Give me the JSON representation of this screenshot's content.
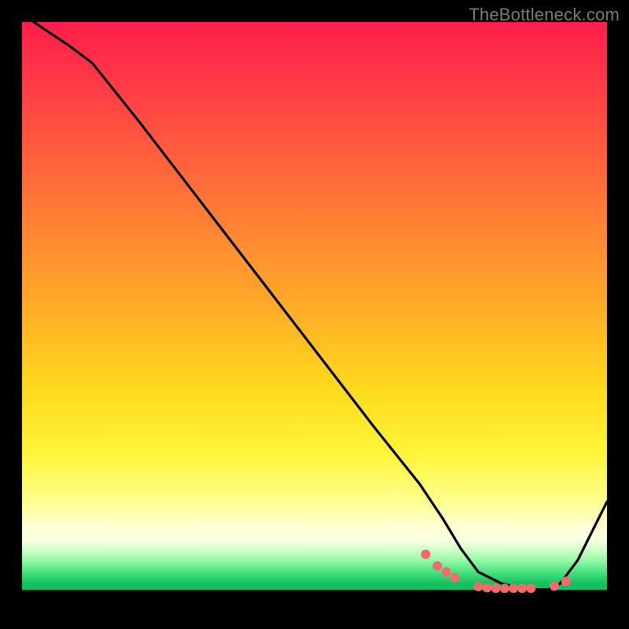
{
  "watermark": "TheBottleneck.com",
  "chart_data": {
    "type": "line",
    "title": "",
    "xlabel": "",
    "ylabel": "",
    "xlim": [
      0,
      100
    ],
    "ylim": [
      0,
      100
    ],
    "grid": false,
    "series": [
      {
        "name": "curve",
        "x": [
          2,
          5,
          8,
          12,
          20,
          30,
          40,
          50,
          60,
          68,
          72,
          75,
          78,
          82,
          86,
          90,
          92,
          95,
          100
        ],
        "y": [
          100,
          98,
          96,
          93,
          83,
          70,
          57,
          44,
          31,
          21,
          15,
          10,
          6,
          4,
          3,
          3,
          4,
          8,
          18
        ]
      }
    ],
    "marker_cluster": {
      "color": "#f06b6b",
      "points_x": [
        69,
        71,
        72.5,
        74,
        78,
        79.5,
        81,
        82.5,
        84,
        85.5,
        87,
        91,
        93
      ],
      "points_y": [
        9,
        7,
        6,
        5,
        3.5,
        3.3,
        3.2,
        3.2,
        3.2,
        3.2,
        3.2,
        3.6,
        4.4
      ]
    },
    "gradient_bands": [
      {
        "color": "#ff1d4c",
        "stop": 0
      },
      {
        "color": "#ffd81c",
        "stop": 62
      },
      {
        "color": "#ffffd8",
        "stop": 87
      },
      {
        "color": "#14c05e",
        "stop": 96
      },
      {
        "color": "#000000",
        "stop": 97.2
      }
    ]
  }
}
